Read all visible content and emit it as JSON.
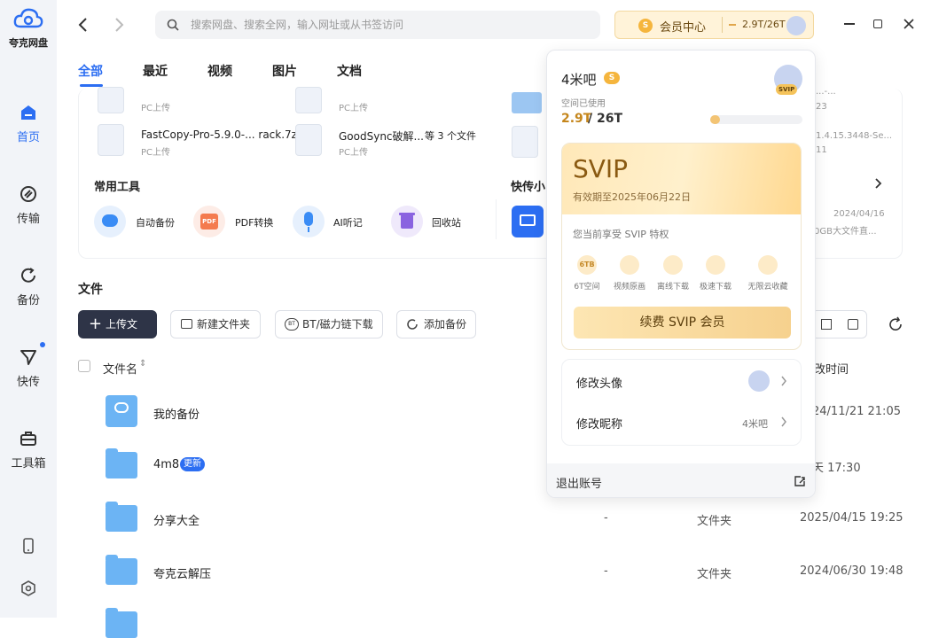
{
  "app": {
    "name": "夸克网盘"
  },
  "sidebar": {
    "items": [
      {
        "label": "首页",
        "icon": "home-icon"
      },
      {
        "label": "传输",
        "icon": "transfer-icon"
      },
      {
        "label": "备份",
        "icon": "backup-icon"
      },
      {
        "label": "快传",
        "icon": "quick-send-icon"
      },
      {
        "label": "工具箱",
        "icon": "toolbox-icon"
      }
    ]
  },
  "topbar": {
    "search_placeholder": "搜索网盘、搜索全网，输入网址或从书签访问",
    "member_center": "会员中心",
    "storage": "2.9T/26T"
  },
  "tabs": [
    "全部",
    "最近",
    "视频",
    "图片",
    "文档"
  ],
  "recent": {
    "row1": [
      {
        "name": "",
        "sub": "PC上传"
      },
      {
        "name": "",
        "sub": "PC上传"
      },
      {
        "name": "",
        "sub": "23"
      }
    ],
    "row2": [
      {
        "name": "FastCopy-Pro-5.9.0-... rack.7z",
        "sub": "PC上传"
      },
      {
        "name": "GoodSync破解...",
        "count": "等 3 个文件",
        "sub": "PC上传"
      },
      {
        "name": "1.4.15.3448-Se...",
        "sub": "11"
      }
    ],
    "partial_top": "...-..."
  },
  "tools": {
    "title": "常用工具",
    "items": [
      {
        "label": "自动备份"
      },
      {
        "label": "PDF转换",
        "badge": "PDF"
      },
      {
        "label": "AI听记"
      },
      {
        "label": "回收站"
      }
    ]
  },
  "quick": {
    "title": "快传小",
    "date": "2024/04/16",
    "desc": "0GB大文件直..."
  },
  "files": {
    "section_title": "文件",
    "buttons": {
      "upload": "上传文件",
      "new_folder": "新建文件夹",
      "bt": "BT/磁力链下载",
      "add_backup": "添加备份"
    },
    "header": {
      "name": "文件名",
      "time": "改时间"
    },
    "rows": [
      {
        "name": "我的备份",
        "size": "",
        "type": "",
        "time": "24/11/21 21:05"
      },
      {
        "name": "4m8",
        "badge": "更新",
        "size": "",
        "type": "",
        "time": "天 17:30"
      },
      {
        "name": "分享大全",
        "size": "-",
        "type": "文件夹",
        "time": "2025/04/15 19:25"
      },
      {
        "name": "夸克云解压",
        "size": "-",
        "type": "文件夹",
        "time": "2024/06/30 19:48"
      }
    ]
  },
  "popup": {
    "username": "4米吧",
    "space_label": "空间已使用",
    "used": "2.9T",
    "total": "/ 26T",
    "usage_fraction": 0.11,
    "avatar_badge": "SVIP",
    "svip": {
      "title": "SVIP",
      "expiry": "有效期至2025年06月22日",
      "enjoy": "您当前享受 SVIP 特权",
      "privileges": [
        {
          "label": "6T空间",
          "icon_text": "6TB"
        },
        {
          "label": "视频原画",
          "icon_text": ""
        },
        {
          "label": "离线下载",
          "icon_text": ""
        },
        {
          "label": "极速下载",
          "icon_text": ""
        },
        {
          "label": "无限云收藏",
          "icon_text": ""
        }
      ],
      "renew": "续费 SVIP 会员"
    },
    "settings": [
      {
        "label": "修改头像"
      },
      {
        "label": "修改昵称",
        "value": "4米吧"
      }
    ],
    "logout": "退出账号"
  },
  "colors": {
    "accent": "#2c6ef2",
    "vip_gold": "#f6d18e"
  }
}
